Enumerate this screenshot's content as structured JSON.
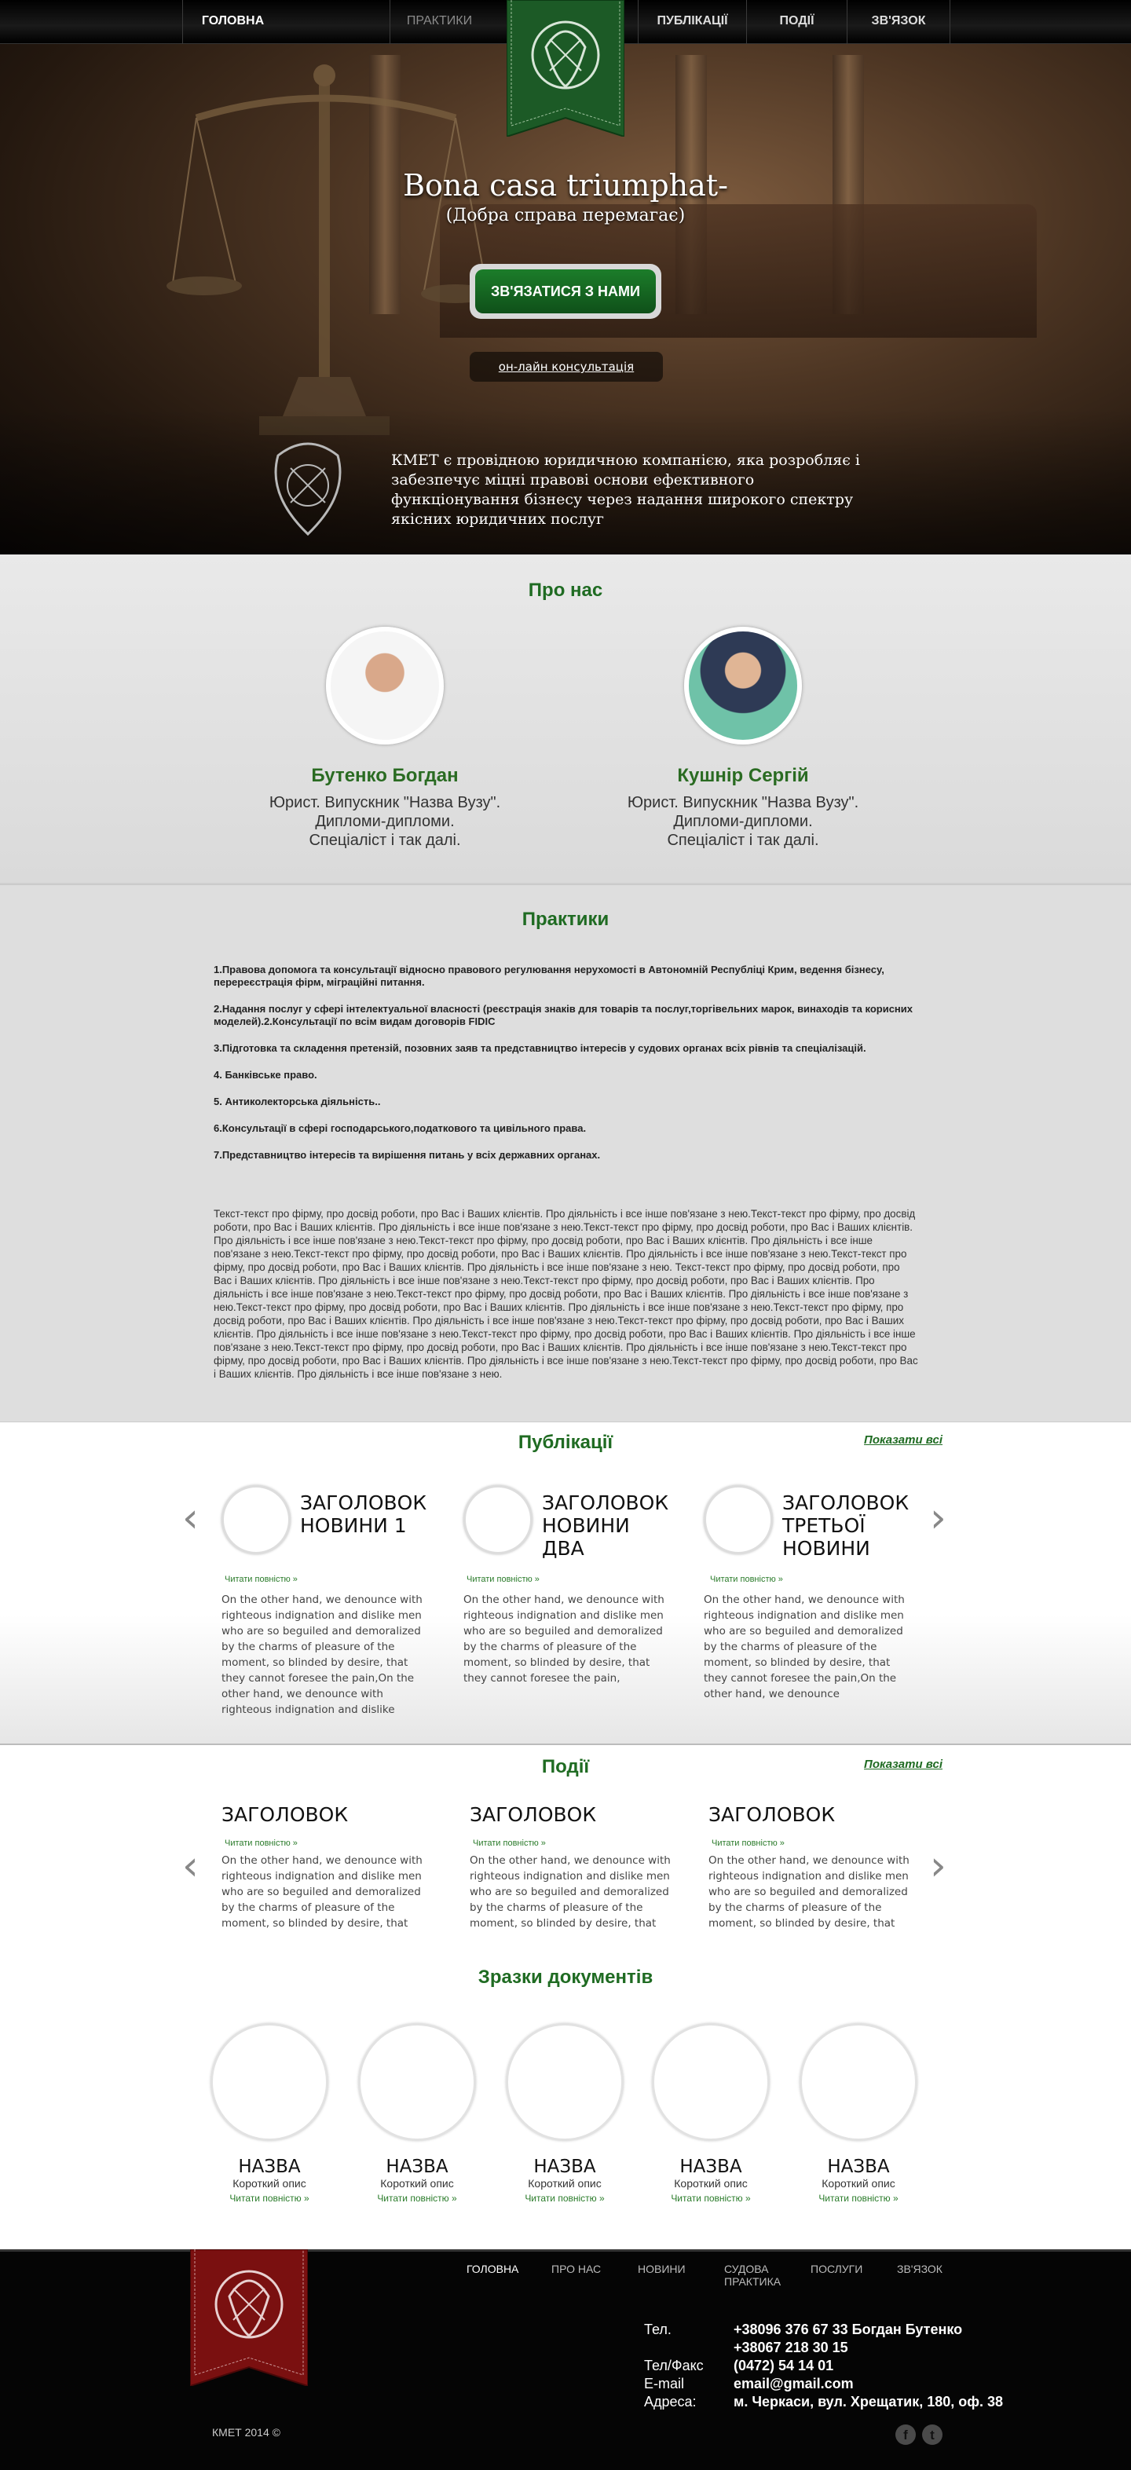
{
  "nav": {
    "items": [
      {
        "label": "ГОЛОВНА"
      },
      {
        "label": "ПРАКТИКИ"
      },
      {
        "label": "ПУБЛІКАЦІЇ"
      },
      {
        "label": "ПОДІЇ"
      },
      {
        "label": "ЗВ'ЯЗОК"
      }
    ]
  },
  "hero": {
    "motto": "Bona casa triumphat-",
    "motto_translation": "(Добра справа перемагає)",
    "contact_button": "ЗВ'ЯЗАТИСЯ З НАМИ",
    "online_link": "он-лайн консультація",
    "description": "КМЕТ є провідною юридичною компанією, яка розробляє і забезпечує міцні правові основи ефективного функціонування бізнесу через надання широкого спектру якісних юридичних послуг"
  },
  "about": {
    "title": "Про нас",
    "people": [
      {
        "name": "Бутенко Богдан",
        "line1": "Юрист. Випускник \"Назва Вузу\".",
        "line2": "Дипломи-дипломи.",
        "line3": "Спеціаліст і так далі."
      },
      {
        "name": "Кушнір Сергій",
        "line1": "Юрист. Випускник \"Назва Вузу\".",
        "line2": "Дипломи-дипломи.",
        "line3": "Спеціаліст і так далі."
      }
    ]
  },
  "practices": {
    "title": "Практики",
    "items": [
      "1.Правова допомога та консультації відносно правового регулювання нерухомості в Автономній Республіці Крим, ведення бізнесу, перереєстрація фірм, міграційні питання.",
      "2.Надання послуг у сфері інтелектуальної власності (реєстрація знаків для товарів та послуг,торгівельних марок, винаходів та корисних моделей).2.Консультації по всім видам договорів FIDIC",
      "3.Підготовка та складення претензій, позовних заяв та представництво інтересів у судових органах всіх рівнів та спеціалізацій.",
      "4. Банківське право.",
      "5. Антиколекторська діяльність..",
      "6.Консультації в сфері господарського,податкового та цивільного права.",
      "7.Представництво інтересів та вирішення питань у всіх державних органах."
    ],
    "text": "Текст-текст про фірму, про досвід роботи, про Вас і Ваших клієнтів. Про діяльність і все інше пов'язане з нею.Текст-текст про фірму, про досвід роботи, про Вас і Ваших клієнтів. Про діяльність і все інше пов'язане з нею.Текст-текст про фірму, про досвід роботи, про Вас і Ваших клієнтів. Про діяльність і все інше пов'язане з нею.Текст-текст про фірму, про досвід роботи, про Вас і Ваших клієнтів. Про діяльність і все інше пов'язане з нею.Текст-текст про фірму, про досвід роботи, про Вас і Ваших клієнтів. Про діяльність і все інше пов'язане з нею.Текст-текст про фірму, про досвід роботи, про Вас і Ваших клієнтів. Про діяльність і все інше пов'язане з нею. Текст-текст про фірму, про досвід роботи, про Вас і Ваших клієнтів. Про діяльність і все інше пов'язане з нею.Текст-текст про фірму, про досвід роботи, про Вас і Ваших клієнтів. Про діяльність і все інше пов'язане з нею.Текст-текст про фірму, про досвід роботи, про Вас і Ваших клієнтів. Про діяльність і все інше пов'язане з нею.Текст-текст про фірму, про досвід роботи, про Вас і Ваших клієнтів. Про діяльність і все інше пов'язане з нею.Текст-текст про фірму, про досвід роботи, про Вас і Ваших клієнтів. Про діяльність і все інше пов'язане з нею.Текст-текст про фірму, про досвід роботи, про Вас і Ваших клієнтів. Про діяльність і все інше пов'язане з нею.Текст-текст про фірму, про досвід роботи, про Вас і Ваших клієнтів. Про діяльність і все інше пов'язане з нею.Текст-текст про фірму, про досвід роботи, про Вас і Ваших клієнтів. Про діяльність і все інше пов'язане з нею.Текст-текст про фірму, про досвід роботи, про Вас і Ваших клієнтів. Про діяльність і все інше пов'язане з нею.Текст-текст про фірму, про досвід роботи, про Вас і Ваших клієнтів. Про діяльність і все інше пов'язане з нею."
  },
  "publications": {
    "title": "Публікації",
    "show_all": "Показати всі",
    "items": [
      {
        "title": "ЗАГОЛОВОК НОВИНИ 1",
        "read_more": "Читати повністю »",
        "text": "On the other hand, we denounce with righteous indignation and dislike men who are so beguiled and demoralized by the charms of pleasure of the moment, so blinded by desire, that they cannot foresee the pain,On the other hand, we denounce with righteous indignation and dislike"
      },
      {
        "title": "ЗАГОЛОВОК НОВИНИ ДВА",
        "read_more": "Читати повністю »",
        "text": "On the other hand, we denounce with righteous indignation and dislike men who are so beguiled and demoralized by the charms of pleasure of the moment, so blinded by desire, that they cannot foresee the pain,"
      },
      {
        "title": "ЗАГОЛОВОК ТРЕТЬОЇ НОВИНИ",
        "read_more": "Читати повністю »",
        "text": "On the other hand, we denounce with righteous indignation and dislike men who are so beguiled and demoralized by the charms of pleasure of the moment, so blinded by desire, that they cannot foresee the pain,On the other hand, we denounce"
      }
    ]
  },
  "events": {
    "title": "Події",
    "show_all": "Показати всі",
    "items": [
      {
        "title": "ЗАГОЛОВОК",
        "read_more": "Читати повністю »",
        "text": "On the other hand, we denounce with righteous indignation and dislike men who are so beguiled and demoralized by the charms of pleasure of the moment, so blinded by desire, that"
      },
      {
        "title": "ЗАГОЛОВОК",
        "read_more": "Читати повністю »",
        "text": "On the other hand, we denounce with righteous indignation and dislike men who are so beguiled and demoralized by the charms of pleasure of the moment, so blinded by desire, that"
      },
      {
        "title": "ЗАГОЛОВОК",
        "read_more": "Читати повністю »",
        "text": "On the other hand, we denounce with righteous indignation and dislike men who are so beguiled and demoralized by the charms of pleasure of the moment, so blinded by desire, that"
      }
    ]
  },
  "documents": {
    "title": "Зразки документів",
    "items": [
      {
        "name": "НАЗВА",
        "desc": "Короткий опис",
        "read_more": "Читати повністю »"
      },
      {
        "name": "НАЗВА",
        "desc": "Короткий опис",
        "read_more": "Читати повністю »"
      },
      {
        "name": "НАЗВА",
        "desc": "Короткий опис",
        "read_more": "Читати повністю »"
      },
      {
        "name": "НАЗВА",
        "desc": "Короткий опис",
        "read_more": "Читати повністю »"
      },
      {
        "name": "НАЗВА",
        "desc": "Короткий опис",
        "read_more": "Читати повністю »"
      }
    ]
  },
  "footer": {
    "links": [
      "ГОЛОВНА",
      "ПРО НАС",
      "НОВИНИ",
      "СУДОВА",
      "ПРАКТИКА",
      "ПОСЛУГИ",
      "ЗВ'ЯЗОК"
    ],
    "contacts": {
      "phone_label": "Тел.",
      "phone1": "+38096 376 67 33 Богдан Бутенко",
      "phone2": "+38067 218 30 15",
      "fax_label": "Тел/Факс",
      "fax": "(0472) 54 14 01",
      "email_label": "E-mail",
      "email": "email@gmail.com",
      "address_label": "Адреса:",
      "address": "м. Черкаси, вул. Хрещатик, 180, оф. 38"
    },
    "copyright": "КМЕТ 2014 ©",
    "social": [
      "facebook-icon",
      "twitter-icon"
    ]
  },
  "colors": {
    "accent_green": "#1f6b22",
    "badge_green": "#1c5a26",
    "footer_badge_red": "#7a1010"
  }
}
